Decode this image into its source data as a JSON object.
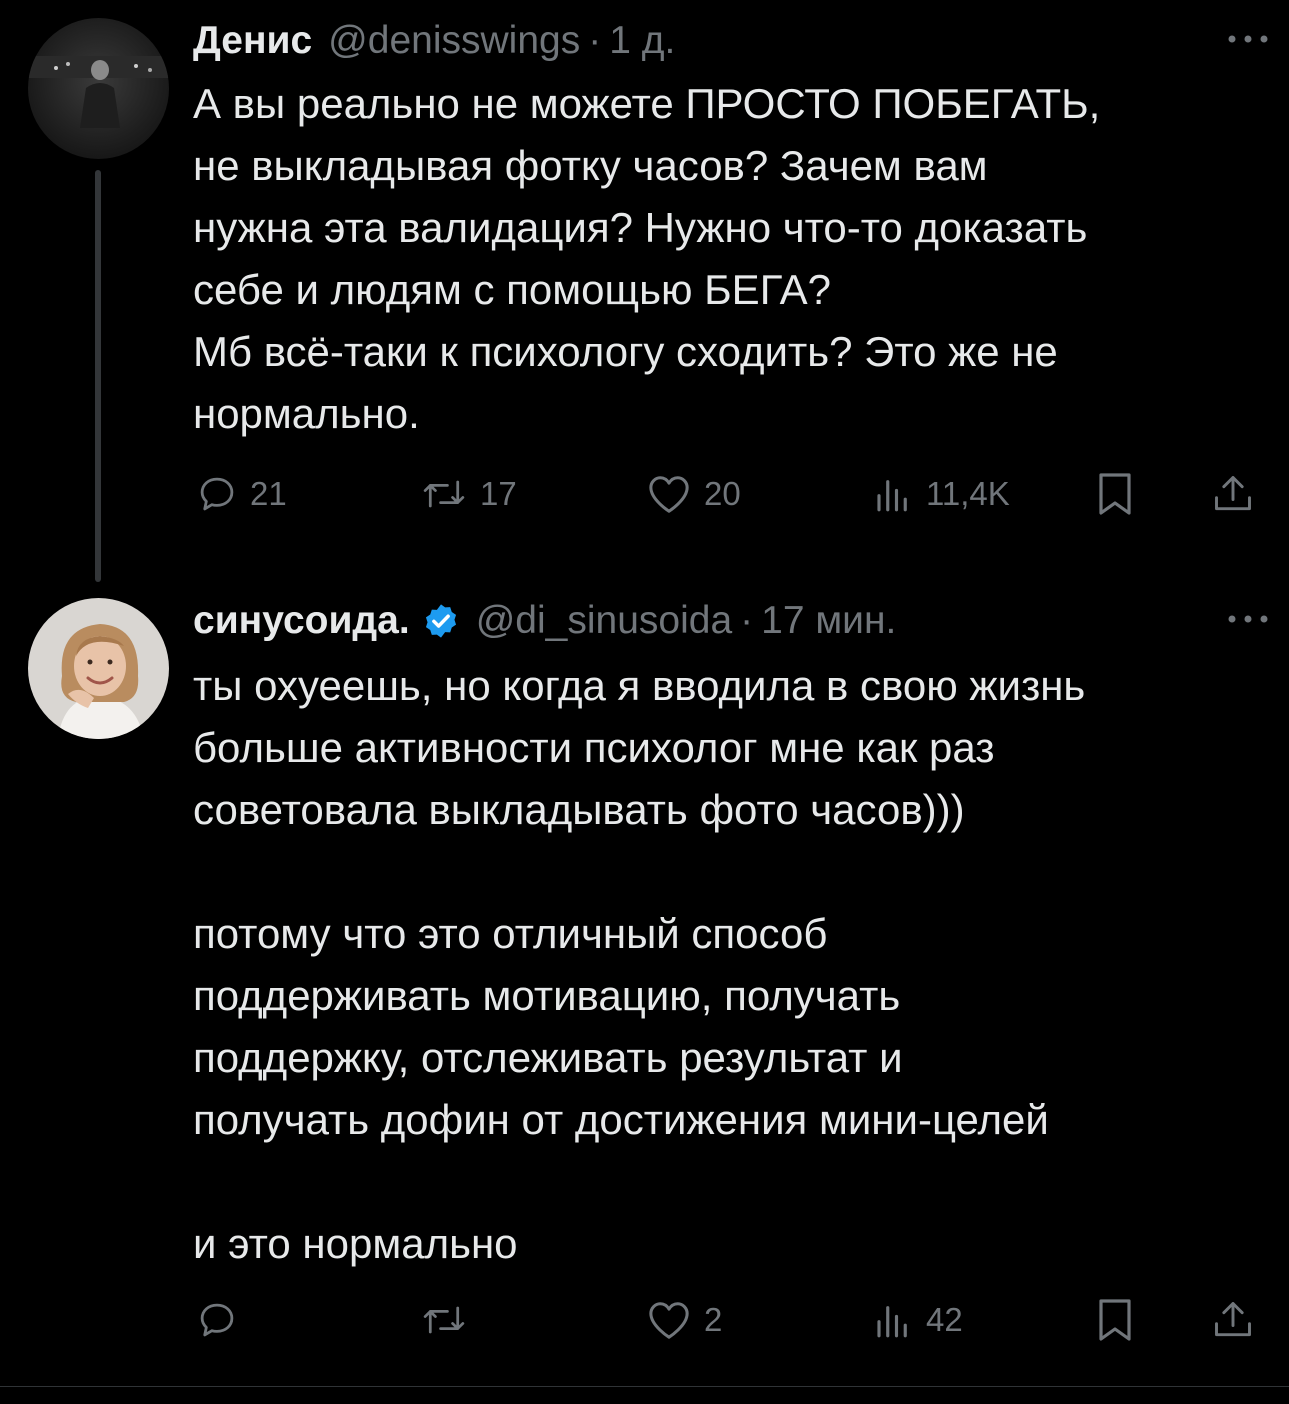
{
  "tweets": [
    {
      "name": "Денис",
      "handle": "@denisswings",
      "separator": "·",
      "time": "1 д.",
      "text": "А вы реально не можете ПРОСТО ПОБЕГАТЬ,\nне выкладывая фотку часов? Зачем вам\nнужна эта валидация? Нужно что-то доказать\nсебе и людям с помощью БЕГА?\nМб всё-таки к психологу сходить? Это же не\nнормально.",
      "actions": {
        "replies": "21",
        "reposts": "17",
        "likes": "20",
        "views": "11,4K"
      }
    },
    {
      "name": "синусоида.",
      "verified": true,
      "handle": "@di_sinusoida",
      "separator": "·",
      "time": "17 мин.",
      "text": "ты охуеешь, но когда я вводила в свою жизнь\nбольше активности психолог мне как раз\nсоветовала выкладывать фото часов)))\n\nпотому что это отличный способ\nподдерживать мотивацию, получать\nподдержку, отслеживать результат и\nполучать дофин от достижения мини-целей\n\nи это нормально",
      "actions": {
        "replies": "",
        "reposts": "",
        "likes": "2",
        "views": "42"
      }
    }
  ],
  "colors": {
    "background": "#000000",
    "text": "#e7e9ea",
    "secondary": "#71767b",
    "thread_line": "#333639",
    "verified": "#1d9bf0"
  },
  "icons": [
    "reply-icon",
    "repost-icon",
    "like-icon",
    "views-icon",
    "bookmark-icon",
    "share-icon",
    "more-icon",
    "verified-icon"
  ]
}
